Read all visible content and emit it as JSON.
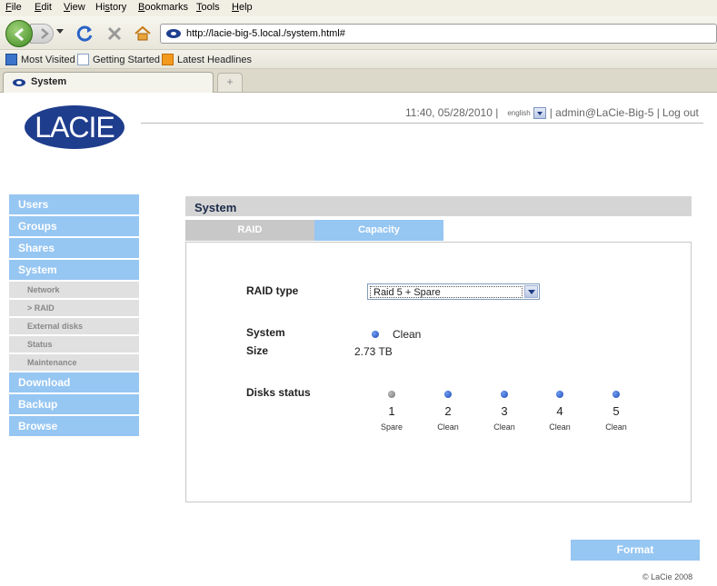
{
  "browser": {
    "menu": [
      {
        "label": "File"
      },
      {
        "label": "Edit"
      },
      {
        "label": "View"
      },
      {
        "label": "History"
      },
      {
        "label": "Bookmarks"
      },
      {
        "label": "Tools"
      },
      {
        "label": "Help"
      }
    ],
    "url": "http://lacie-big-5.local./system.html#",
    "bookmarks": [
      "Most Visited",
      "Getting Started",
      "Latest Headlines"
    ],
    "tab_title": "System",
    "new_tab_symbol": "+"
  },
  "header": {
    "logo": "LACIE",
    "datetime": "11:40, 05/28/2010 |",
    "language": "english",
    "user": "| admin@LaCie-Big-5 |",
    "logout": "Log out"
  },
  "sidebar": {
    "items": [
      {
        "label": "Users",
        "type": "main"
      },
      {
        "label": "Groups",
        "type": "main"
      },
      {
        "label": "Shares",
        "type": "main"
      },
      {
        "label": "System",
        "type": "main"
      },
      {
        "label": "Network",
        "type": "sub"
      },
      {
        "label": "> RAID",
        "type": "sub"
      },
      {
        "label": "External disks",
        "type": "sub"
      },
      {
        "label": "Status",
        "type": "sub"
      },
      {
        "label": "Maintenance",
        "type": "sub"
      },
      {
        "label": "Download",
        "type": "main"
      },
      {
        "label": "Backup",
        "type": "main"
      },
      {
        "label": "Browse",
        "type": "main"
      }
    ]
  },
  "main": {
    "section_title": "System",
    "tabs": [
      {
        "label": "RAID"
      },
      {
        "label": "Capacity"
      }
    ],
    "raid_type_label": "RAID type",
    "raid_type_value": "Raid 5 + Spare",
    "system_label": "System",
    "system_status": "Clean",
    "size_label": "Size",
    "size_value": "2.73 TB",
    "disks_label": "Disks status",
    "disks": [
      {
        "num": "1",
        "state": "Spare",
        "color": "#888888"
      },
      {
        "num": "2",
        "state": "Clean",
        "color": "#1f49b5"
      },
      {
        "num": "3",
        "state": "Clean",
        "color": "#1f49b5"
      },
      {
        "num": "4",
        "state": "Clean",
        "color": "#1f49b5"
      },
      {
        "num": "5",
        "state": "Clean",
        "color": "#1f49b5"
      }
    ],
    "format_button": "Format"
  },
  "footer": {
    "copyright": "© LaCie 2008"
  },
  "colors": {
    "accent": "#96c6f2",
    "brand": "#1f3d8d"
  }
}
